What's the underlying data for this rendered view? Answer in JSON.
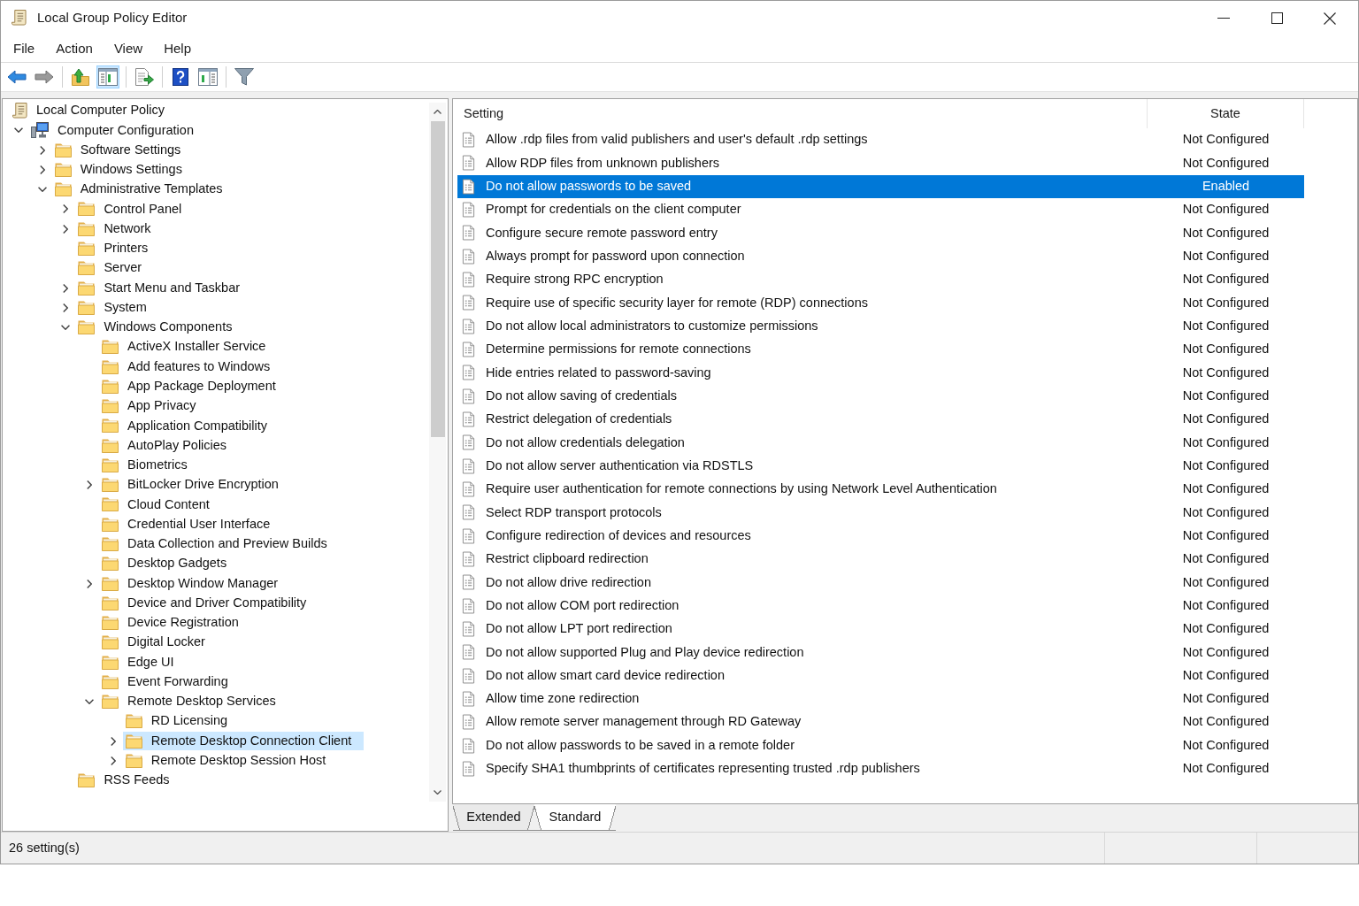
{
  "window": {
    "title": "Local Group Policy Editor"
  },
  "menu": [
    "File",
    "Action",
    "View",
    "Help"
  ],
  "toolbar": [
    {
      "kind": "back",
      "disabled": false
    },
    {
      "kind": "forward",
      "disabled": true
    },
    {
      "kind": "separator"
    },
    {
      "kind": "up"
    },
    {
      "kind": "console_tree",
      "pressed": true
    },
    {
      "kind": "separator"
    },
    {
      "kind": "export"
    },
    {
      "kind": "separator"
    },
    {
      "kind": "help"
    },
    {
      "kind": "action_pane",
      "pressed": false
    },
    {
      "kind": "separator"
    },
    {
      "kind": "filter"
    }
  ],
  "tree": [
    {
      "label": "Local Computer Policy",
      "kind": "policy",
      "selected": false,
      "children": [
        {
          "label": "Computer Configuration",
          "kind": "computer",
          "expanded": true,
          "selected": false,
          "children": [
            {
              "label": "Software Settings",
              "kind": "folder",
              "expanded": false,
              "selected": false
            },
            {
              "label": "Windows Settings",
              "kind": "folder",
              "expanded": false,
              "selected": false
            },
            {
              "label": "Administrative Templates",
              "kind": "folder",
              "expanded": true,
              "selected": false,
              "children": [
                {
                  "label": "Control Panel",
                  "kind": "folder",
                  "expanded": false,
                  "selected": false
                },
                {
                  "label": "Network",
                  "kind": "folder",
                  "expanded": false,
                  "selected": false
                },
                {
                  "label": "Printers",
                  "kind": "folder",
                  "selected": false
                },
                {
                  "label": "Server",
                  "kind": "folder",
                  "selected": false
                },
                {
                  "label": "Start Menu and Taskbar",
                  "kind": "folder",
                  "expanded": false,
                  "selected": false
                },
                {
                  "label": "System",
                  "kind": "folder",
                  "expanded": false,
                  "selected": false
                },
                {
                  "label": "Windows Components",
                  "kind": "folder",
                  "expanded": true,
                  "selected": false,
                  "children": [
                    {
                      "label": "ActiveX Installer Service",
                      "kind": "folder",
                      "selected": false
                    },
                    {
                      "label": "Add features to Windows",
                      "kind": "folder",
                      "selected": false
                    },
                    {
                      "label": "App Package Deployment",
                      "kind": "folder",
                      "selected": false
                    },
                    {
                      "label": "App Privacy",
                      "kind": "folder",
                      "selected": false
                    },
                    {
                      "label": "Application Compatibility",
                      "kind": "folder",
                      "selected": false
                    },
                    {
                      "label": "AutoPlay Policies",
                      "kind": "folder",
                      "selected": false
                    },
                    {
                      "label": "Biometrics",
                      "kind": "folder",
                      "selected": false
                    },
                    {
                      "label": "BitLocker Drive Encryption",
                      "kind": "folder",
                      "expanded": false,
                      "selected": false
                    },
                    {
                      "label": "Cloud Content",
                      "kind": "folder",
                      "selected": false
                    },
                    {
                      "label": "Credential User Interface",
                      "kind": "folder",
                      "selected": false
                    },
                    {
                      "label": "Data Collection and Preview Builds",
                      "kind": "folder",
                      "selected": false
                    },
                    {
                      "label": "Desktop Gadgets",
                      "kind": "folder",
                      "selected": false
                    },
                    {
                      "label": "Desktop Window Manager",
                      "kind": "folder",
                      "expanded": false,
                      "selected": false
                    },
                    {
                      "label": "Device and Driver Compatibility",
                      "kind": "folder",
                      "selected": false
                    },
                    {
                      "label": "Device Registration",
                      "kind": "folder",
                      "selected": false
                    },
                    {
                      "label": "Digital Locker",
                      "kind": "folder",
                      "selected": false
                    },
                    {
                      "label": "Edge UI",
                      "kind": "folder",
                      "selected": false
                    },
                    {
                      "label": "Event Forwarding",
                      "kind": "folder",
                      "selected": false
                    },
                    {
                      "label": "Remote Desktop Services",
                      "kind": "folder",
                      "expanded": true,
                      "selected": false,
                      "children": [
                        {
                          "label": "RD Licensing",
                          "kind": "folder",
                          "selected": false
                        },
                        {
                          "label": "Remote Desktop Connection Client",
                          "kind": "folder",
                          "expanded": false,
                          "selected": true
                        },
                        {
                          "label": "Remote Desktop Session Host",
                          "kind": "folder",
                          "expanded": false,
                          "selected": false
                        }
                      ]
                    }
                  ]
                },
                {
                  "label": "RSS Feeds",
                  "kind": "folder",
                  "selected": false
                }
              ]
            }
          ]
        }
      ]
    }
  ],
  "table": {
    "columns": [
      "Setting",
      "State"
    ],
    "rows": [
      {
        "setting": "Allow .rdp files from valid publishers and user's default .rdp settings",
        "state": "Not Configured",
        "selected": false
      },
      {
        "setting": "Allow RDP files from unknown publishers",
        "state": "Not Configured",
        "selected": false
      },
      {
        "setting": "Do not allow passwords to be saved",
        "state": "Enabled",
        "selected": true
      },
      {
        "setting": "Prompt for credentials on the client computer",
        "state": "Not Configured",
        "selected": false
      },
      {
        "setting": "Configure secure remote password entry",
        "state": "Not Configured",
        "selected": false
      },
      {
        "setting": "Always prompt for password upon connection",
        "state": "Not Configured",
        "selected": false
      },
      {
        "setting": "Require strong RPC encryption",
        "state": "Not Configured",
        "selected": false
      },
      {
        "setting": "Require use of specific security layer for remote (RDP) connections",
        "state": "Not Configured",
        "selected": false
      },
      {
        "setting": "Do not allow local administrators to customize permissions",
        "state": "Not Configured",
        "selected": false
      },
      {
        "setting": "Determine permissions for remote connections",
        "state": "Not Configured",
        "selected": false
      },
      {
        "setting": "Hide entries related to password-saving",
        "state": "Not Configured",
        "selected": false
      },
      {
        "setting": "Do not allow saving of credentials",
        "state": "Not Configured",
        "selected": false
      },
      {
        "setting": "Restrict delegation of credentials",
        "state": "Not Configured",
        "selected": false
      },
      {
        "setting": "Do not allow credentials delegation",
        "state": "Not Configured",
        "selected": false
      },
      {
        "setting": "Do not allow server authentication via RDSTLS",
        "state": "Not Configured",
        "selected": false
      },
      {
        "setting": "Require user authentication for remote connections by using Network Level Authentication",
        "state": "Not Configured",
        "selected": false
      },
      {
        "setting": "Select RDP transport protocols",
        "state": "Not Configured",
        "selected": false
      },
      {
        "setting": "Configure redirection of devices and resources",
        "state": "Not Configured",
        "selected": false
      },
      {
        "setting": "Restrict clipboard redirection",
        "state": "Not Configured",
        "selected": false
      },
      {
        "setting": "Do not allow drive redirection",
        "state": "Not Configured",
        "selected": false
      },
      {
        "setting": "Do not allow COM port redirection",
        "state": "Not Configured",
        "selected": false
      },
      {
        "setting": "Do not allow LPT port redirection",
        "state": "Not Configured",
        "selected": false
      },
      {
        "setting": "Do not allow supported Plug and Play device redirection",
        "state": "Not Configured",
        "selected": false
      },
      {
        "setting": "Do not allow smart card device redirection",
        "state": "Not Configured",
        "selected": false
      },
      {
        "setting": "Allow time zone redirection",
        "state": "Not Configured",
        "selected": false
      },
      {
        "setting": "Allow remote server management through RD Gateway",
        "state": "Not Configured",
        "selected": false
      },
      {
        "setting": "Do not allow passwords to be saved in a remote folder",
        "state": "Not Configured",
        "selected": false
      },
      {
        "setting": "Specify SHA1 thumbprints of certificates representing trusted .rdp publishers",
        "state": "Not Configured",
        "selected": false
      }
    ]
  },
  "tabs": [
    {
      "label": "Extended",
      "selected": false
    },
    {
      "label": "Standard",
      "selected": true
    }
  ],
  "status_bar": {
    "text": "26 setting(s)"
  }
}
